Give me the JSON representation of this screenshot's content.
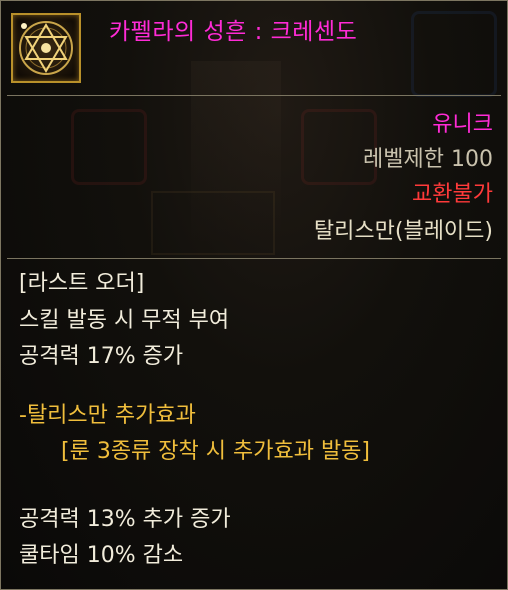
{
  "item": {
    "name": "카펠라의 성흔 : 크레센도",
    "icon": "hexagram-seal-icon",
    "rarity": "유니크",
    "level_requirement": "레벨제한 100",
    "trade": "교환불가",
    "type": "탈리스만(블레이드)"
  },
  "skill_effect": {
    "title": "[라스트 오더]",
    "lines": [
      "스킬 발동 시 무적 부여",
      "공격력 17% 증가"
    ]
  },
  "talisman_bonus": {
    "title": "-탈리스만 추가효과",
    "condition": "[룬 3종류 장착 시 추가효과 발동]",
    "lines": [
      "공격력 13% 추가 증가",
      "쿨타임 10% 감소"
    ]
  },
  "colors": {
    "name": "#ff2bd6",
    "rarity": "#ff2bd6",
    "level": "#c9c2ad",
    "trade": "#ff3a3a",
    "type": "#e6dfc6",
    "body": "#f1ecdb",
    "bonus": "#f0be3c"
  }
}
